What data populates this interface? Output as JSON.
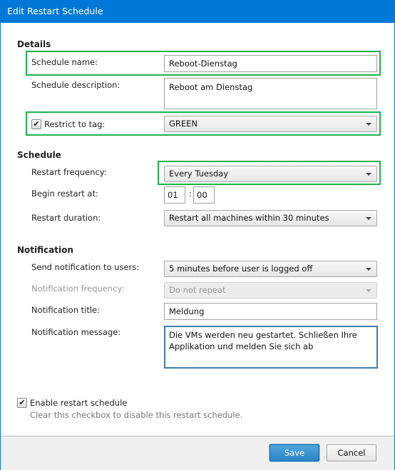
{
  "window": {
    "title": "Edit Restart Schedule",
    "accent": "#0078d7",
    "highlight": "#22b14c"
  },
  "details": {
    "heading": "Details",
    "name_label": "Schedule name:",
    "name_value": "Reboot-Dienstag",
    "description_label": "Schedule description:",
    "description_value": "Reboot am Dienstag",
    "restrict_label": "Restrict to tag:",
    "restrict_checked": true,
    "tag_value": "GREEN"
  },
  "schedule": {
    "heading": "Schedule",
    "frequency_label": "Restart frequency:",
    "frequency_value": "Every Tuesday",
    "begin_label": "Begin restart at:",
    "hour": "01",
    "separator": ":",
    "minute": "00",
    "duration_label": "Restart duration:",
    "duration_value": "Restart all machines within 30 minutes"
  },
  "notification": {
    "heading": "Notification",
    "send_label": "Send notification to users:",
    "send_value": "5 minutes before user is logged off",
    "frequency_label": "Notification frequency:",
    "frequency_value": "Do not repeat",
    "title_label": "Notification title:",
    "title_value": "Meldung",
    "message_label": "Notification message:",
    "message_value": "Die VMs werden neu gestartet. Schließen Ihre Applikation und melden Sie sich ab"
  },
  "enable": {
    "label": "Enable restart schedule",
    "checked": true,
    "help": "Clear this checkbox to disable this restart schedule."
  },
  "footer": {
    "save": "Save",
    "cancel": "Cancel"
  }
}
